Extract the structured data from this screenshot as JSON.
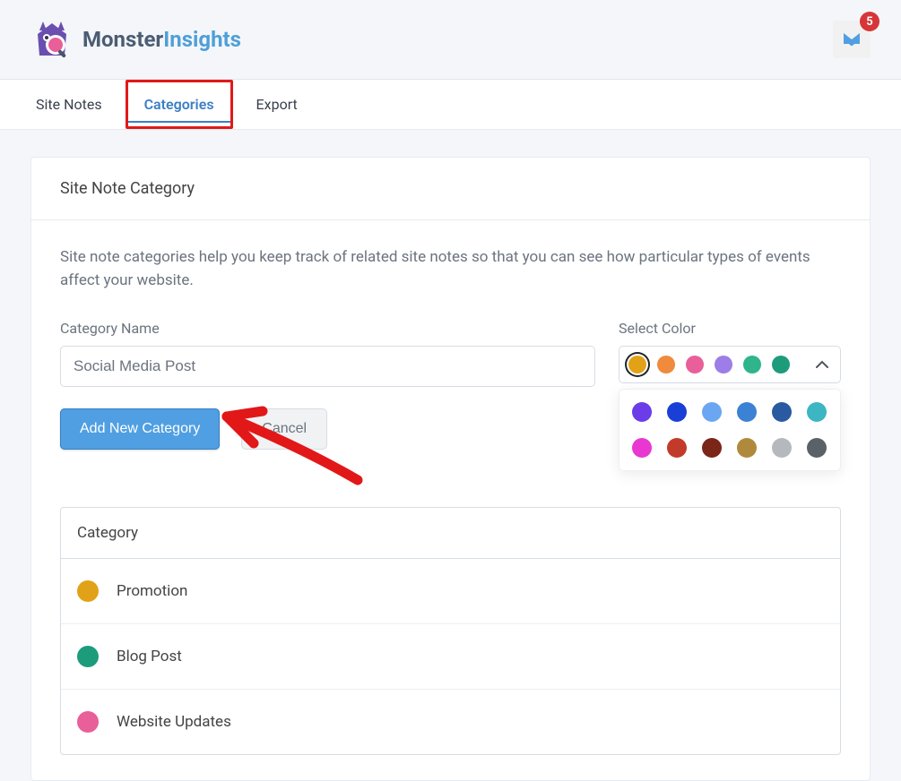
{
  "logo": {
    "text_dark": "Monster",
    "text_light": "Insights"
  },
  "inbox": {
    "count": "5"
  },
  "tabs": {
    "site_notes": "Site Notes",
    "categories": "Categories",
    "export": "Export"
  },
  "panel": {
    "title": "Site Note Category",
    "description": "Site note categories help you keep track of related site notes so that you can see how particular types of events affect your website."
  },
  "form": {
    "name_label": "Category Name",
    "name_value": "Social Media Post",
    "color_label": "Select Color",
    "add_button": "Add New Category",
    "cancel_button": "Cancel"
  },
  "color_picker": {
    "visible_swatches": [
      "#e2a217",
      "#f08a3c",
      "#e85f9a",
      "#9d7de8",
      "#2fb48b",
      "#1d9c7c"
    ],
    "selected_index": 0,
    "dropdown_swatches": [
      "#6a3de8",
      "#1a3fd6",
      "#6ba6f2",
      "#3b82d4",
      "#2a5aa0",
      "#3bb6c2",
      "#e838d1",
      "#c23b2a",
      "#7a2618",
      "#b08a3c",
      "#b5b9bd",
      "#5a6268"
    ]
  },
  "table": {
    "header": "Category",
    "rows": [
      {
        "label": "Promotion",
        "color": "#e2a217"
      },
      {
        "label": "Blog Post",
        "color": "#1d9c7c"
      },
      {
        "label": "Website Updates",
        "color": "#e85f9a"
      }
    ]
  }
}
